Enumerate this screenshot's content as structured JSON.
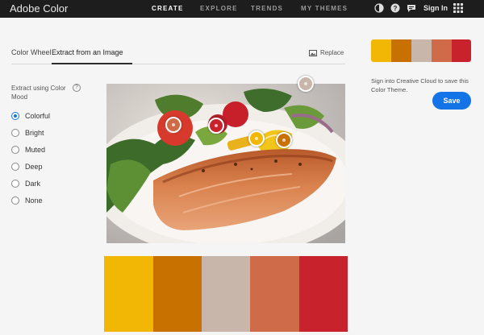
{
  "app": {
    "brand": "Adobe Color"
  },
  "nav": {
    "items": [
      {
        "label": "CREATE",
        "active": true
      },
      {
        "label": "EXPLORE",
        "active": false
      },
      {
        "label": "TRENDS",
        "active": false
      },
      {
        "label": "MY THEMES",
        "active": false
      }
    ]
  },
  "topbar": {
    "signin": "Sign In",
    "icons": [
      "theme-toggle-icon",
      "help-icon",
      "feedback-icon",
      "apps-grid-icon"
    ]
  },
  "tabs": {
    "color_wheel": "Color Wheel",
    "extract": "Extract from an Image",
    "active": "extract"
  },
  "replace": {
    "label": "Replace",
    "icon": "image-icon"
  },
  "mood": {
    "label": "Extract using Color Mood",
    "options": [
      "Colorful",
      "Bright",
      "Muted",
      "Deep",
      "Dark",
      "None"
    ],
    "selected": "Colorful"
  },
  "palette": {
    "colors": [
      "#f2b705",
      "#c87100",
      "#c8b6aa",
      "#d06b4a",
      "#c8232c"
    ]
  },
  "save": {
    "message": "Sign into Creative Cloud to save this Color Theme.",
    "button": "Save"
  }
}
